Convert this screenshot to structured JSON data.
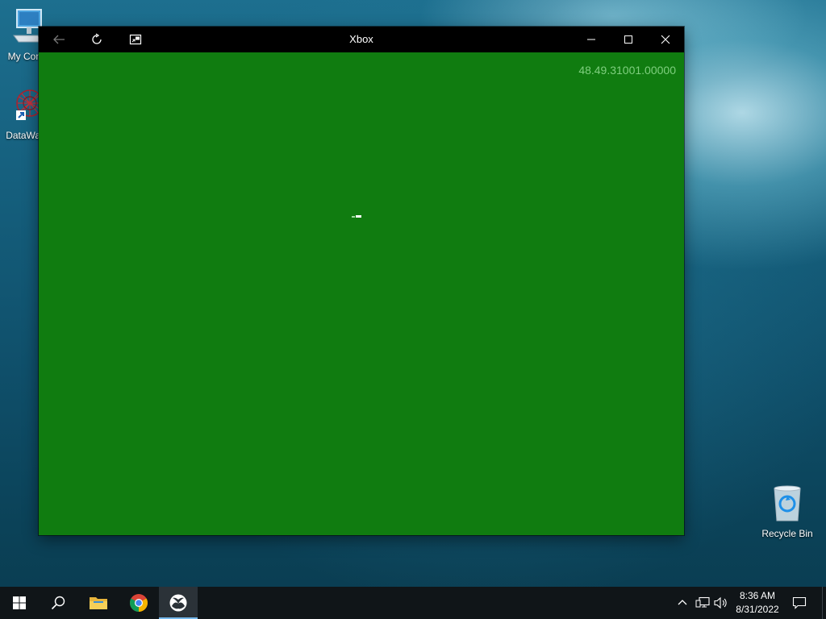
{
  "desktop": {
    "icons": [
      {
        "label": "My Com"
      },
      {
        "label": "DataWag"
      },
      {
        "label": "Recycle Bin"
      }
    ]
  },
  "window": {
    "title": "Xbox",
    "version_text": "48.49.31001.00000",
    "background_color": "#107c10",
    "controls": [
      "back-icon",
      "refresh-icon",
      "compact-overlay-icon",
      "minimize-icon",
      "maximize-icon",
      "close-icon"
    ]
  },
  "taskbar": {
    "items": [
      "start-icon",
      "search-icon",
      "file-explorer-icon",
      "chrome-icon",
      "xbox-icon"
    ],
    "active_item": "xbox-icon",
    "tray": [
      "chevron-up-icon",
      "network-icon",
      "volume-icon"
    ],
    "time": "8:36 AM",
    "date": "8/31/2022",
    "notification_icon": "action-center-icon"
  }
}
